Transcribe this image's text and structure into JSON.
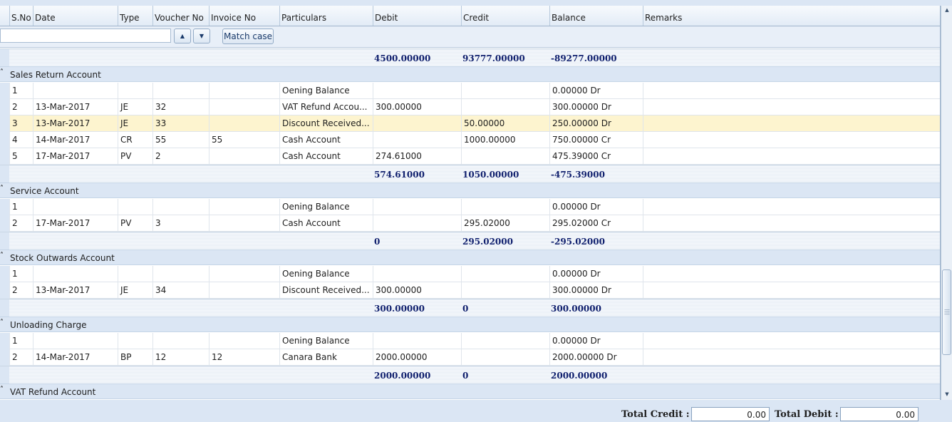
{
  "columns": [
    "S.No",
    "Date",
    "Type",
    "Voucher No",
    "Invoice No",
    "Particulars",
    "Debit",
    "Credit",
    "Balance",
    "Remarks"
  ],
  "filter": {
    "search_value": "",
    "up_icon": "triangle-up",
    "down_icon": "triangle-down",
    "match_case_label": "Match case"
  },
  "top_summary": {
    "debit": "4500.00000",
    "credit": "93777.00000",
    "balance": "-89277.00000"
  },
  "groups": [
    {
      "title": "Sales Return Account",
      "rows": [
        {
          "sno": "1",
          "date": "",
          "type": "",
          "voucher": "",
          "invoice": "",
          "particulars": "Oening Balance",
          "debit": "",
          "credit": "",
          "balance": "0.00000 Dr",
          "remarks": ""
        },
        {
          "sno": "2",
          "date": "13-Mar-2017",
          "type": "JE",
          "voucher": "32",
          "invoice": "",
          "particulars": "VAT  Refund Accou...",
          "debit": "300.00000",
          "credit": "",
          "balance": "300.00000 Dr",
          "remarks": ""
        },
        {
          "sno": "3",
          "date": "13-Mar-2017",
          "type": "JE",
          "voucher": "33",
          "invoice": "",
          "particulars": "Discount Received...",
          "debit": "",
          "credit": "50.00000",
          "balance": "250.00000 Dr",
          "remarks": ""
        },
        {
          "sno": "4",
          "date": "14-Mar-2017",
          "type": "CR",
          "voucher": "55",
          "invoice": "55",
          "particulars": "Cash Account",
          "debit": "",
          "credit": "1000.00000",
          "balance": "750.00000 Cr",
          "remarks": ""
        },
        {
          "sno": "5",
          "date": "17-Mar-2017",
          "type": "PV",
          "voucher": "2",
          "invoice": "",
          "particulars": "Cash Account",
          "debit": "274.61000",
          "credit": "",
          "balance": "475.39000 Cr",
          "remarks": ""
        }
      ],
      "summary": {
        "debit": "574.61000",
        "credit": "1050.00000",
        "balance": "-475.39000"
      }
    },
    {
      "title": "Service Account",
      "rows": [
        {
          "sno": "1",
          "date": "",
          "type": "",
          "voucher": "",
          "invoice": "",
          "particulars": "Oening Balance",
          "debit": "",
          "credit": "",
          "balance": "0.00000 Dr",
          "remarks": ""
        },
        {
          "sno": "2",
          "date": "17-Mar-2017",
          "type": "PV",
          "voucher": "3",
          "invoice": "",
          "particulars": "Cash Account",
          "debit": "",
          "credit": "295.02000",
          "balance": "295.02000 Cr",
          "remarks": ""
        }
      ],
      "summary": {
        "debit": "0",
        "credit": "295.02000",
        "balance": "-295.02000"
      }
    },
    {
      "title": "Stock Outwards Account",
      "rows": [
        {
          "sno": "1",
          "date": "",
          "type": "",
          "voucher": "",
          "invoice": "",
          "particulars": "Oening Balance",
          "debit": "",
          "credit": "",
          "balance": "0.00000 Dr",
          "remarks": ""
        },
        {
          "sno": "2",
          "date": "13-Mar-2017",
          "type": "JE",
          "voucher": "34",
          "invoice": "",
          "particulars": "Discount Received...",
          "debit": "300.00000",
          "credit": "",
          "balance": "300.00000 Dr",
          "remarks": ""
        }
      ],
      "summary": {
        "debit": "300.00000",
        "credit": "0",
        "balance": "300.00000"
      }
    },
    {
      "title": "Unloading Charge",
      "rows": [
        {
          "sno": "1",
          "date": "",
          "type": "",
          "voucher": "",
          "invoice": "",
          "particulars": "Oening Balance",
          "debit": "",
          "credit": "",
          "balance": "0.00000 Dr",
          "remarks": ""
        },
        {
          "sno": "2",
          "date": "14-Mar-2017",
          "type": "BP",
          "voucher": "12",
          "invoice": "12",
          "particulars": "Canara Bank",
          "debit": "2000.00000",
          "credit": "",
          "balance": "2000.00000 Dr",
          "remarks": ""
        }
      ],
      "summary": {
        "debit": "2000.00000",
        "credit": "0",
        "balance": "2000.00000"
      }
    },
    {
      "title": "VAT  Refund Account",
      "rows": [],
      "summary": null
    }
  ],
  "highlighted": {
    "group": 0,
    "row": 2
  },
  "footer": {
    "total_credit_label": "Total Credit :",
    "total_credit_value": "0.00",
    "total_debit_label": "Total Debit :",
    "total_debit_value": "0.00"
  },
  "colors": {
    "highlight_row": "#fdf4cf",
    "summary_text": "#10206e",
    "group_band": "#dbe6f4"
  }
}
